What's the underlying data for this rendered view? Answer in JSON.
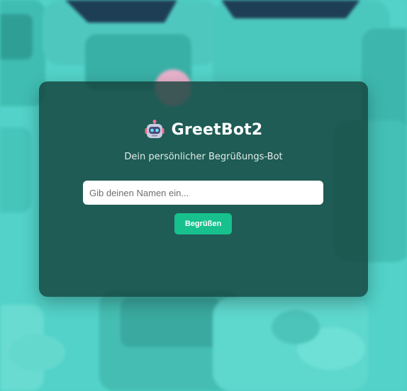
{
  "app": {
    "title": "GreetBot2",
    "icon": "robot-icon",
    "subtitle": "Dein persönlicher Begrüßungs-Bot"
  },
  "form": {
    "name_placeholder": "Gib deinen Namen ein...",
    "name_value": "",
    "greet_label": "Begrüßen"
  },
  "theme": {
    "background": "#4fd0c6",
    "card": "#123e38",
    "button": "#17c08d",
    "title_text": "#ffffff"
  }
}
